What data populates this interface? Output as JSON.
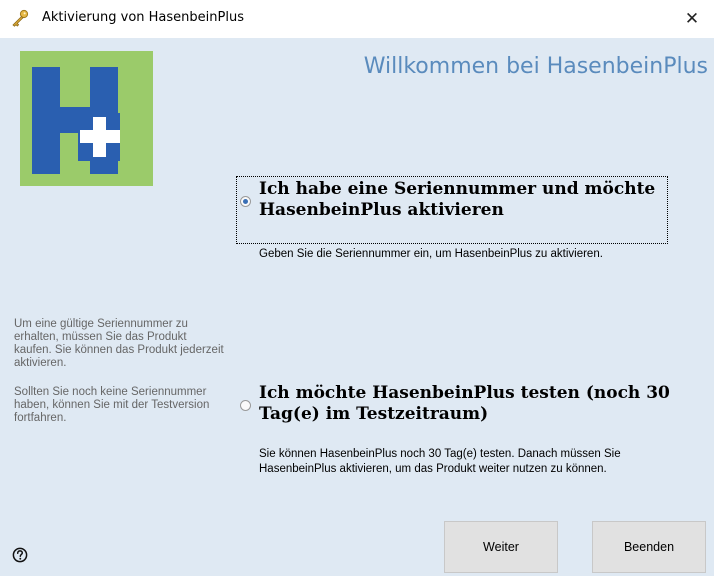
{
  "window": {
    "title": "Aktivierung von HasenbeinPlus",
    "close_glyph": "✕",
    "title_icon": "key-icon"
  },
  "header": {
    "welcome": "Willkommen bei HasenbeinPlus",
    "logo": "hasenbeinplus-logo",
    "logo_colors": {
      "background": "#9bcb6a",
      "letter": "#2a5fb0",
      "plus": "#ffffff"
    }
  },
  "options": {
    "serial": {
      "label": "Ich habe eine Seriennummer und möchte HasenbeinPlus aktivieren",
      "description": "Geben Sie die Seriennummer ein, um HasenbeinPlus zu aktivieren.",
      "selected": true
    },
    "trial": {
      "label": "Ich möchte HasenbeinPlus testen (noch 30 Tag(e) im Testzeitraum)",
      "description": "Sie können HasenbeinPlus noch 30 Tag(e) testen. Danach müssen Sie HasenbeinPlus aktivieren, um das Produkt weiter nutzen zu können.",
      "selected": false
    }
  },
  "sidebar": {
    "info1": "Um eine gültige Seriennummer zu erhalten, müssen Sie das Produkt kaufen. Sie können das Produkt jederzeit aktivieren.",
    "info2": "Sollten Sie noch keine Seriennummer haben, können Sie mit der Testversion fortfahren."
  },
  "buttons": {
    "next": "Weiter",
    "quit": "Beenden"
  },
  "help": {
    "icon": "help-icon",
    "glyph": "?"
  },
  "colors": {
    "client_background": "#dfe9f3",
    "accent_text": "#5a8bbd",
    "button_background": "#e1e1e1"
  }
}
